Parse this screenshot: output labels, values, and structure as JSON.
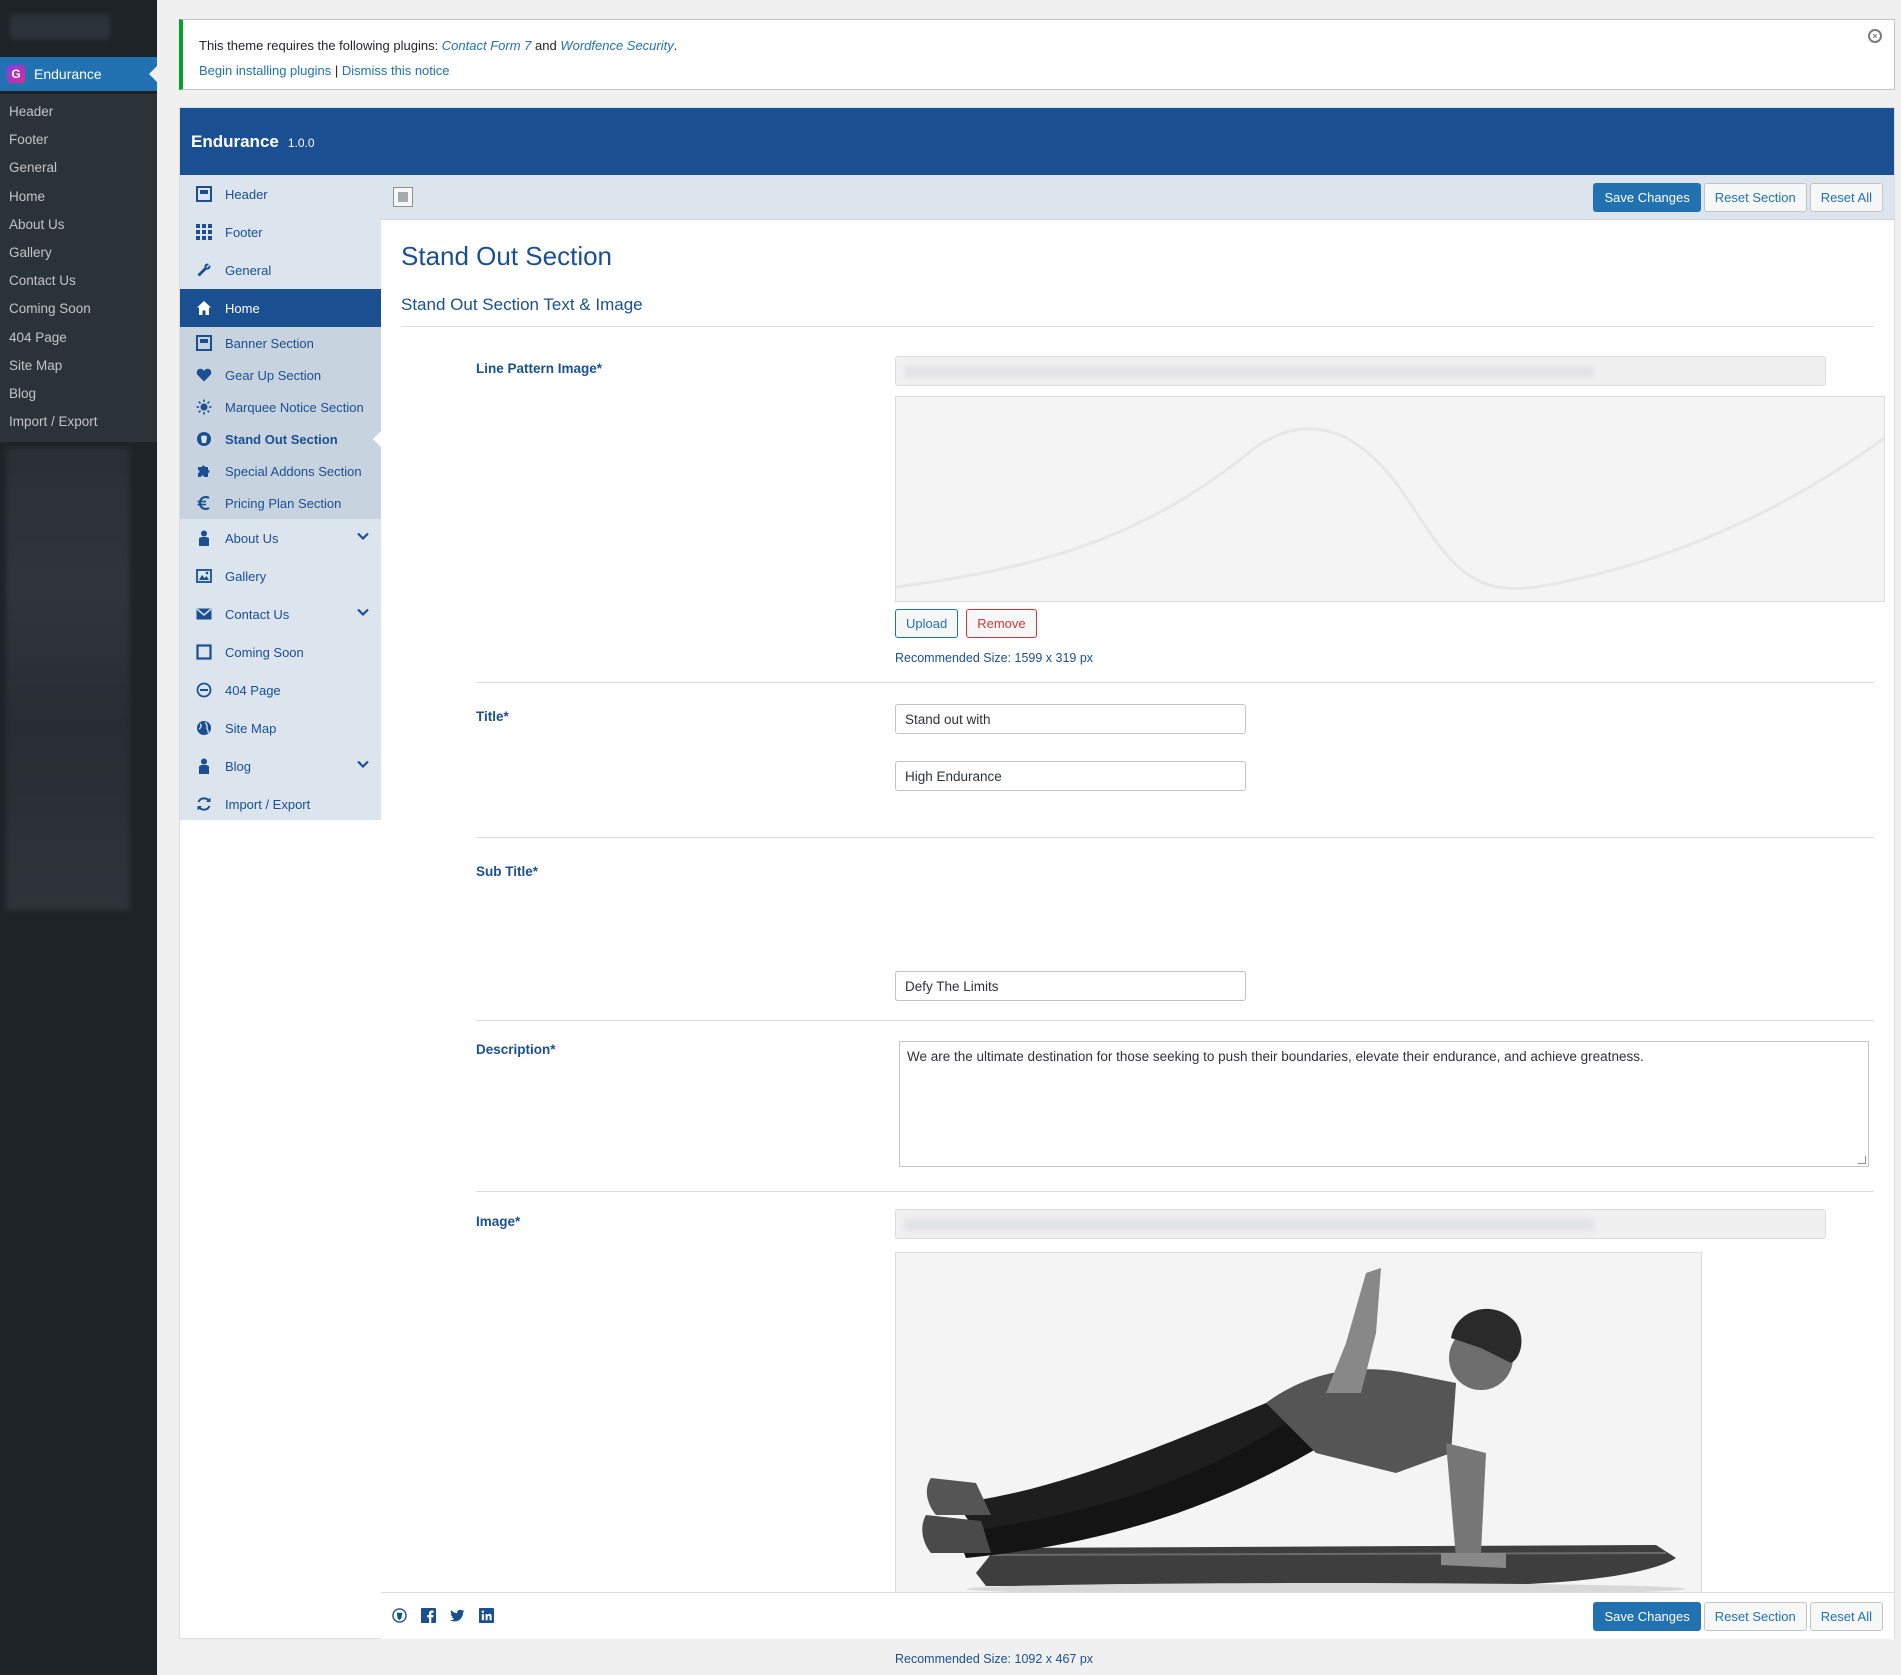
{
  "wp_menu": {
    "active_label": "Endurance",
    "active_logo": "G",
    "submenu": [
      "Header",
      "Footer",
      "General",
      "Home",
      "About Us",
      "Gallery",
      "Contact Us",
      "Coming Soon",
      "404 Page",
      "Site Map",
      "Blog",
      "Import / Export"
    ]
  },
  "notice": {
    "text_before": "This theme requires the following plugins: ",
    "plugin1": "Contact Form 7",
    "and": " and ",
    "plugin2": "Wordfence Security",
    "period": ".",
    "begin_link": "Begin installing plugins",
    "divider": " | ",
    "dismiss_link": "Dismiss this notice",
    "close_icon": "×"
  },
  "panel": {
    "theme_name": "Endurance",
    "version": "1.0.0",
    "nav": {
      "header": "Header",
      "footer": "Footer",
      "general": "General",
      "home": "Home",
      "home_sub": {
        "banner": "Banner Section",
        "gear_up": "Gear Up Section",
        "marquee": "Marquee Notice Section",
        "stand_out": "Stand Out Section",
        "special_addons": "Special Addons Section",
        "pricing": "Pricing Plan Section"
      },
      "about": "About Us",
      "gallery": "Gallery",
      "contact": "Contact Us",
      "coming_soon": "Coming Soon",
      "p404": "404 Page",
      "site_map": "Site Map",
      "blog": "Blog",
      "import_export": "Import / Export"
    },
    "buttons": {
      "save": "Save Changes",
      "reset_section": "Reset Section",
      "reset_all": "Reset All"
    },
    "section_title": "Stand Out Section",
    "subsection_title": "Stand Out Section Text & Image",
    "fields": {
      "line_pattern_label": "Line Pattern Image*",
      "upload": "Upload",
      "remove": "Remove",
      "line_pattern_rec": "Recommended Size: 1599 x 319 px",
      "title_label": "Title*",
      "title_line1": "Stand out with",
      "title_line2": "High Endurance",
      "subtitle_label": "Sub Title*",
      "subtitle_value": "Defy The Limits",
      "description_label": "Description*",
      "description_value": "We are the ultimate destination for those seeking to push their boundaries, elevate their endurance, and achieve greatness.",
      "image_label": "Image*",
      "image_rec": "Recommended Size: 1092 x 467 px"
    },
    "footer_icons": [
      "redux-icon",
      "facebook-icon",
      "twitter-icon",
      "linkedin-icon"
    ]
  },
  "colors": {
    "brand_blue": "#1a4f91",
    "wp_blue": "#2271b1",
    "admin_dark": "#1d2327",
    "notice_green": "#00a32a",
    "remove_red": "#d63638"
  }
}
